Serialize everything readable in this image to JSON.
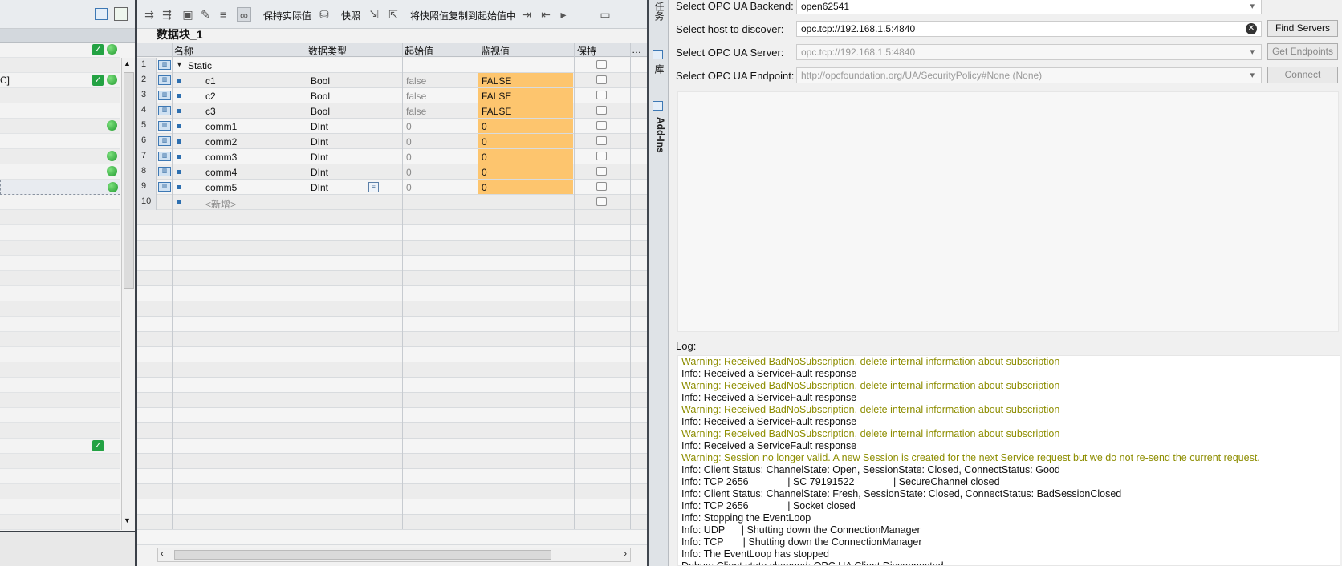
{
  "left_panel": {
    "rows": [
      {
        "text": "",
        "check": true,
        "dot": true
      },
      {
        "text": "",
        "check": false,
        "dot": false
      },
      {
        "text": "C]",
        "check": true,
        "dot": true
      },
      {
        "text": "",
        "check": false,
        "dot": false
      },
      {
        "text": "",
        "check": false,
        "dot": false
      },
      {
        "text": "",
        "check": false,
        "dot": true
      },
      {
        "text": "",
        "check": false,
        "dot": false
      },
      {
        "text": "",
        "check": false,
        "dot": true
      },
      {
        "text": "",
        "check": false,
        "dot": true
      },
      {
        "text": "",
        "check": false,
        "dot": true
      }
    ]
  },
  "toolbar": {
    "keep_actual": "保持实际值",
    "snapshot": "快照",
    "copy_snapshot": "将快照值复制到起始值中"
  },
  "block": {
    "title": "数据块_1",
    "columns": {
      "name": "名称",
      "type": "数据类型",
      "start": "起始值",
      "monitor": "监视值",
      "retain": "保持"
    },
    "rows": [
      {
        "num": "1",
        "name": "Static",
        "type": "",
        "start": "",
        "monitor": "",
        "header": true
      },
      {
        "num": "2",
        "name": "c1",
        "type": "Bool",
        "start": "false",
        "monitor": "FALSE"
      },
      {
        "num": "3",
        "name": "c2",
        "type": "Bool",
        "start": "false",
        "monitor": "FALSE"
      },
      {
        "num": "4",
        "name": "c3",
        "type": "Bool",
        "start": "false",
        "monitor": "FALSE"
      },
      {
        "num": "5",
        "name": "comm1",
        "type": "DInt",
        "start": "0",
        "monitor": "0"
      },
      {
        "num": "6",
        "name": "comm2",
        "type": "DInt",
        "start": "0",
        "monitor": "0"
      },
      {
        "num": "7",
        "name": "comm3",
        "type": "DInt",
        "start": "0",
        "monitor": "0"
      },
      {
        "num": "8",
        "name": "comm4",
        "type": "DInt",
        "start": "0",
        "monitor": "0"
      },
      {
        "num": "9",
        "name": "comm5",
        "type": "DInt",
        "start": "0",
        "monitor": "0"
      },
      {
        "num": "10",
        "name": "<新增>",
        "type": "",
        "start": "",
        "monitor": "",
        "add": true
      }
    ]
  },
  "vertical_tabs": {
    "tasks": "任务",
    "library": "库",
    "addins": "Add-Ins"
  },
  "opc": {
    "backend_label": "Select OPC UA Backend:",
    "backend_value": "open62541",
    "host_label": "Select host to discover:",
    "host_value": "opc.tcp://192.168.1.5:4840",
    "find_servers": "Find Servers",
    "server_label": "Select OPC UA Server:",
    "server_value": "opc.tcp://192.168.1.5:4840",
    "get_endpoints": "Get Endpoints",
    "endpoint_label": "Select OPC UA Endpoint:",
    "endpoint_value": "http://opcfoundation.org/UA/SecurityPolicy#None (None)",
    "connect": "Connect",
    "log_label": "Log:",
    "log": [
      {
        "level": "warning",
        "text": "Warning: Received BadNoSubscription, delete internal information about subscription"
      },
      {
        "level": "info",
        "text": "Info: Received a ServiceFault response"
      },
      {
        "level": "warning",
        "text": "Warning: Received BadNoSubscription, delete internal information about subscription"
      },
      {
        "level": "info",
        "text": "Info: Received a ServiceFault response"
      },
      {
        "level": "warning",
        "text": "Warning: Received BadNoSubscription, delete internal information about subscription"
      },
      {
        "level": "info",
        "text": "Info: Received a ServiceFault response"
      },
      {
        "level": "warning",
        "text": "Warning: Received BadNoSubscription, delete internal information about subscription"
      },
      {
        "level": "info",
        "text": "Info: Received a ServiceFault response"
      },
      {
        "level": "warning",
        "text": "Warning: Session no longer valid. A new Session is created for the next Service request but we do not re-send the current request."
      },
      {
        "level": "info",
        "text": "Info: Client Status: ChannelState: Open, SessionState: Closed, ConnectStatus: Good"
      },
      {
        "level": "info",
        "text": "Info: TCP 2656              | SC 79191522              | SecureChannel closed"
      },
      {
        "level": "info",
        "text": "Info: Client Status: ChannelState: Fresh, SessionState: Closed, ConnectStatus: BadSessionClosed"
      },
      {
        "level": "info",
        "text": "Info: TCP 2656              | Socket closed"
      },
      {
        "level": "info",
        "text": "Info: Stopping the EventLoop"
      },
      {
        "level": "info",
        "text": "Info: UDP      | Shutting down the ConnectionManager"
      },
      {
        "level": "info",
        "text": "Info: TCP       | Shutting down the ConnectionManager"
      },
      {
        "level": "info",
        "text": "Info: The EventLoop has stopped"
      },
      {
        "level": "info",
        "text": "Debug: Client state changed: OPC UA Client Disconnected"
      }
    ]
  },
  "colors": {
    "monitor_bg": "#fdc56e",
    "warning": "#8d8d00",
    "ok_green": "#23a243"
  }
}
